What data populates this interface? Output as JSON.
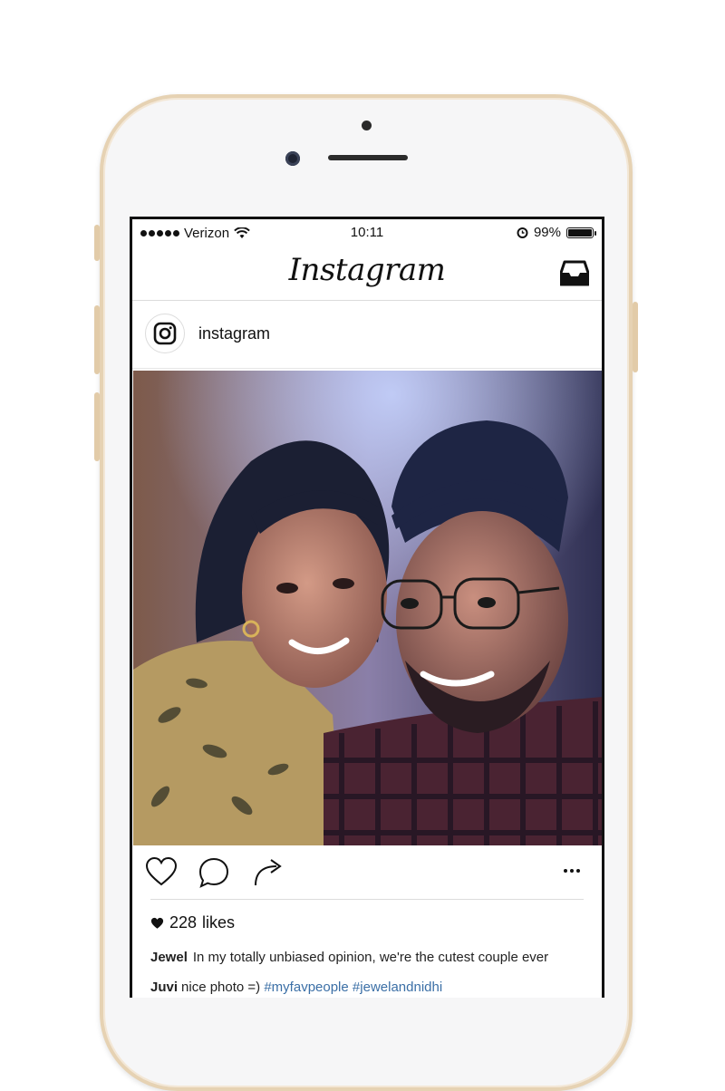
{
  "status_bar": {
    "carrier": "Verizon",
    "time": "10:11",
    "battery": "99%",
    "battery_level": 0.99
  },
  "nav": {
    "logo": "Instagram",
    "inbox_icon": "inbox-icon"
  },
  "post": {
    "username": "instagram",
    "avatar_icon": "instagram-logo-icon",
    "photo_description_icon": "photo",
    "likes_count": "228",
    "likes_label": "likes",
    "caption": {
      "author": "Jewel",
      "text": "In my totally unbiased opinion, we're the cutest couple ever"
    },
    "comment": {
      "author": "Juvi",
      "text": "nice photo =)",
      "tags": [
        "#myfavpeople",
        "#jewelandnidhi"
      ]
    }
  },
  "colors": {
    "phone_frame": "#e6d2b3",
    "hashtag": "#3b6fa6"
  }
}
